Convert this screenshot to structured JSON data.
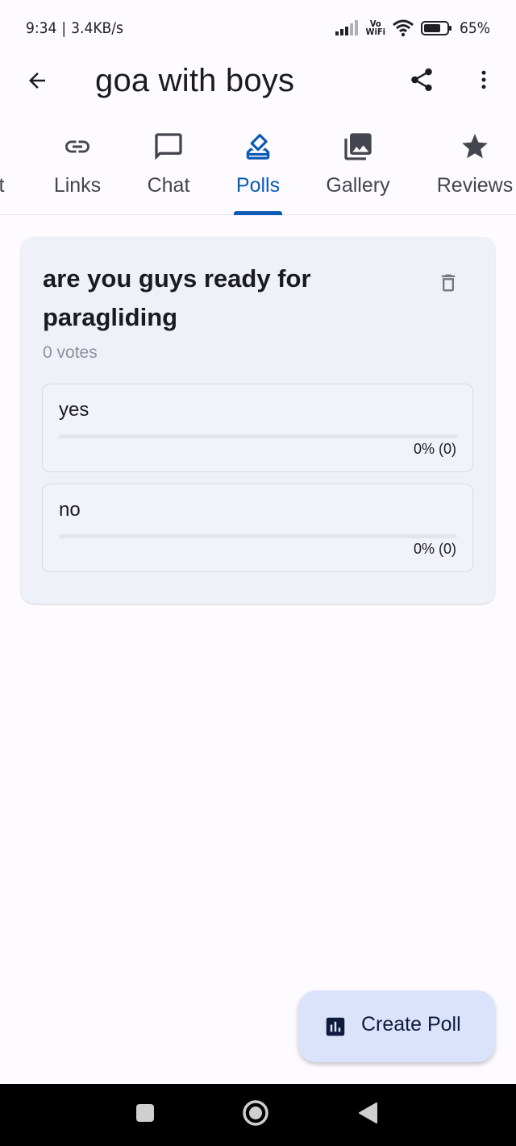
{
  "status_bar": {
    "time": "9:34",
    "separator": "|",
    "speed": "3.4KB/s",
    "vowifi_top": "Vo",
    "vowifi_bottom": "WiFi",
    "battery": "65%"
  },
  "app_bar": {
    "title": "goa with boys",
    "back_icon": "arrow-left-icon",
    "share_icon": "share-icon",
    "more_icon": "more-vert-icon"
  },
  "tabs": [
    {
      "label": "t",
      "icon": "none"
    },
    {
      "label": "Links",
      "icon": "link-icon"
    },
    {
      "label": "Chat",
      "icon": "chat-bubble-icon"
    },
    {
      "label": "Polls",
      "icon": "ballot-icon",
      "active": true
    },
    {
      "label": "Gallery",
      "icon": "photo-library-icon"
    },
    {
      "label": "Reviews",
      "icon": "star-icon"
    }
  ],
  "poll": {
    "question": "are you guys ready for paragliding",
    "votes": "0 votes",
    "options": [
      {
        "label": "yes",
        "result": "0% (0)",
        "fraction": 0
      },
      {
        "label": "no",
        "result": "0% (0)",
        "fraction": 0
      }
    ]
  },
  "fab": {
    "label": "Create Poll",
    "icon": "bar-chart-icon"
  },
  "nav_bar": {
    "recents_icon": "square-icon",
    "home_icon": "circle-icon",
    "back_icon": "triangle-back-icon"
  },
  "colors": {
    "accent": "#0b5bb5",
    "card_bg": "#eff1f9",
    "fab_bg": "#dbe3fb",
    "page_bg": "#fdfbff"
  }
}
